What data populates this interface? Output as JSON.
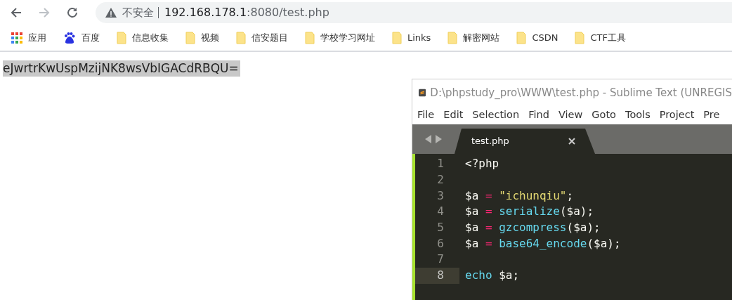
{
  "browser": {
    "address": {
      "security_label": "不安全",
      "host": "192.168.178.1",
      "rest": ":8080/test.php"
    },
    "bookmarks": [
      {
        "kind": "apps",
        "label": "应用"
      },
      {
        "kind": "baidu",
        "label": "百度"
      },
      {
        "kind": "folder",
        "label": "信息收集"
      },
      {
        "kind": "folder",
        "label": "视频"
      },
      {
        "kind": "folder",
        "label": "信安题目"
      },
      {
        "kind": "folder",
        "label": "学校学习网址"
      },
      {
        "kind": "folder",
        "label": "Links"
      },
      {
        "kind": "folder",
        "label": "解密网站"
      },
      {
        "kind": "folder",
        "label": "CSDN"
      },
      {
        "kind": "folder",
        "label": "CTF工具"
      }
    ],
    "page_text": {
      "text": "eJwrtrKwUspMzijNK8wsVbIGACdRBQU=",
      "selected": true
    }
  },
  "editor": {
    "title": "D:\\phpstudy_pro\\WWW\\test.php - Sublime Text (UNREGIS",
    "menu": [
      "File",
      "Edit",
      "Selection",
      "Find",
      "View",
      "Goto",
      "Tools",
      "Project",
      "Pre"
    ],
    "tabs": [
      {
        "label": "test.php",
        "selected": true
      }
    ],
    "lines": [
      {
        "number": "1",
        "current": false,
        "tokens": [
          {
            "kind": "plain",
            "text": "<?php"
          }
        ]
      },
      {
        "number": "2",
        "current": false
      },
      {
        "number": "3",
        "current": false,
        "tokens": [
          {
            "kind": "plain",
            "text": "$a"
          },
          {
            "kind": "op",
            "text": " = "
          },
          {
            "kind": "str",
            "text": "\"ichunqiu\""
          },
          {
            "kind": "plain",
            "text": ";"
          }
        ]
      },
      {
        "number": "4",
        "current": false,
        "tokens": [
          {
            "kind": "plain",
            "text": "$a"
          },
          {
            "kind": "op",
            "text": " = "
          },
          {
            "kind": "fn",
            "text": "serialize"
          },
          {
            "kind": "plain",
            "text": "($a);"
          }
        ]
      },
      {
        "number": "5",
        "current": false,
        "tokens": [
          {
            "kind": "plain",
            "text": "$a"
          },
          {
            "kind": "op",
            "text": " = "
          },
          {
            "kind": "fn",
            "text": "gzcompress"
          },
          {
            "kind": "plain",
            "text": "($a);"
          }
        ]
      },
      {
        "number": "6",
        "current": false,
        "tokens": [
          {
            "kind": "plain",
            "text": "$a"
          },
          {
            "kind": "op",
            "text": " = "
          },
          {
            "kind": "fn",
            "text": "base64_encode"
          },
          {
            "kind": "plain",
            "text": "($a);"
          }
        ]
      },
      {
        "number": "7",
        "current": false
      },
      {
        "number": "8",
        "current": true,
        "tokens": [
          {
            "kind": "fn",
            "text": "echo"
          },
          {
            "kind": "plain",
            "text": " $a;"
          }
        ]
      }
    ]
  }
}
